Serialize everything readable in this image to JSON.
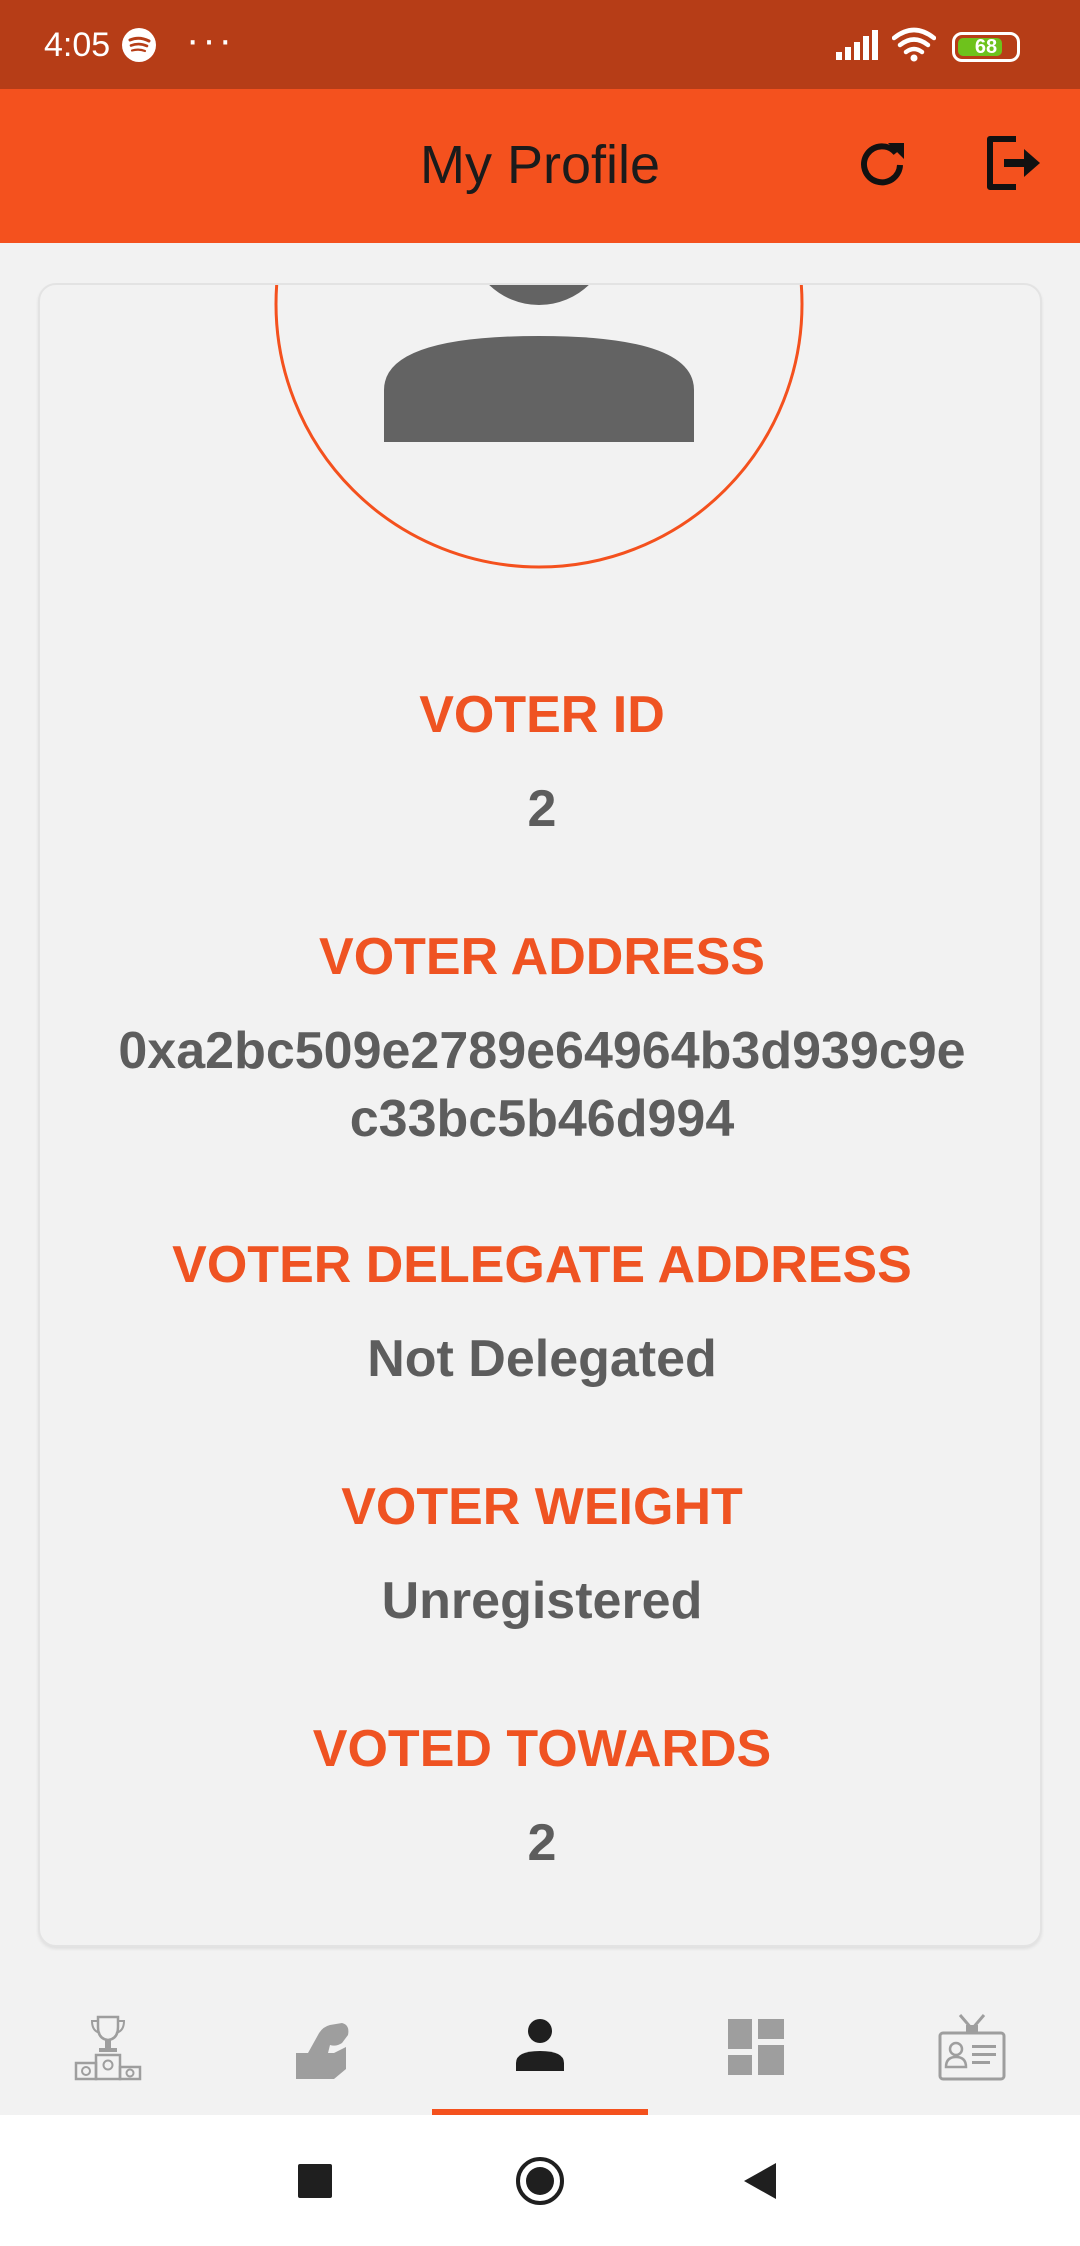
{
  "status_bar": {
    "time": "4:05",
    "dots": "···",
    "battery": "68",
    "icons": [
      "spotify-icon",
      "signal-icon",
      "wifi-icon",
      "battery-icon"
    ]
  },
  "header": {
    "title": "My Profile",
    "refresh_icon": "refresh-icon",
    "logout_icon": "logout-icon",
    "accent_color": "#f4511e"
  },
  "profile": {
    "avatar_icon": "person-avatar-icon",
    "fields": [
      {
        "label": "VOTER ID",
        "value": "2"
      },
      {
        "label": "VOTER ADDRESS",
        "value": "0xa2bc509e2789e64964b3d939c9ec33bc5b46d994"
      },
      {
        "label": "VOTER DELEGATE ADDRESS",
        "value": "Not Delegated"
      },
      {
        "label": "VOTER WEIGHT",
        "value": "Unregistered"
      },
      {
        "label": "VOTED TOWARDS",
        "value": "2"
      }
    ],
    "label_color": "#ef5322",
    "value_color": "#5d5d5d"
  },
  "bottom_nav": {
    "items": [
      {
        "icon": "podium-trophy-icon",
        "active": false
      },
      {
        "icon": "ballot-vote-icon",
        "active": false
      },
      {
        "icon": "person-icon",
        "active": true
      },
      {
        "icon": "dashboard-icon",
        "active": false
      },
      {
        "icon": "id-card-icon",
        "active": false
      }
    ],
    "active_color": "#1f1f1f",
    "inactive_color": "#9e9e9e"
  },
  "system_nav": {
    "icons": [
      "recents-square-icon",
      "home-circle-icon",
      "back-triangle-icon"
    ]
  }
}
